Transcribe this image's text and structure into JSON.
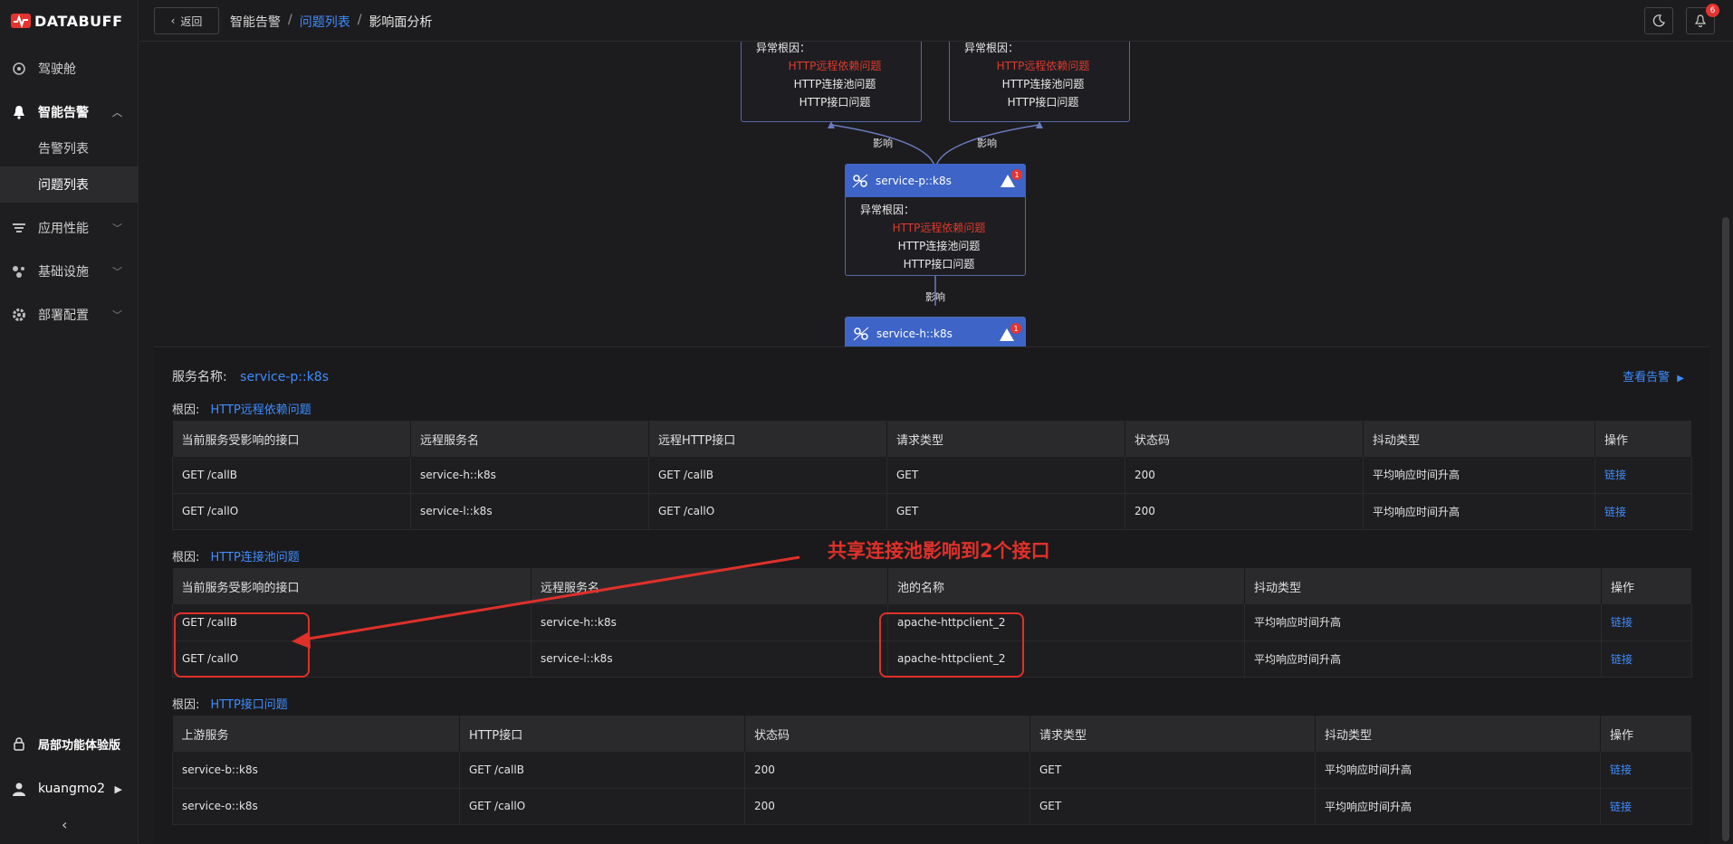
{
  "app": {
    "logo_text": "DATABUFF"
  },
  "sidebar": {
    "items": [
      {
        "label": "驾驶舱",
        "icon": "cockpit-icon"
      },
      {
        "label": "智能告警",
        "icon": "bell-icon"
      },
      {
        "label": "应用性能",
        "icon": "apm-icon"
      },
      {
        "label": "基础设施",
        "icon": "infra-icon"
      },
      {
        "label": "部署配置",
        "icon": "gear-icon"
      }
    ],
    "subitems": [
      "告警列表",
      "问题列表"
    ],
    "trial_label": "局部功能体验版",
    "user_name": "kuangmo2"
  },
  "header": {
    "back_label": "返回",
    "breadcrumb": [
      "智能告警",
      "问题列表",
      "影响面分析"
    ],
    "notification_count": "6"
  },
  "graph": {
    "root_cause_title": "异常根因：",
    "causes": [
      "HTTP远程依赖问题",
      "HTTP连接池问题",
      "HTTP接口问题"
    ],
    "edge_label": "影响",
    "node_p": "service-p::k8s",
    "node_h": "service-h::k8s",
    "alert_count": "1"
  },
  "detail": {
    "service_label": "服务名称:",
    "service_name": "service-p::k8s",
    "view_alerts": "查看告警",
    "cause_prefix": "根因:",
    "tables": [
      {
        "cause": "HTTP远程依赖问题",
        "headers": [
          "当前服务受影响的接口",
          "远程服务名",
          "远程HTTP接口",
          "请求类型",
          "状态码",
          "抖动类型",
          "操作"
        ],
        "rows": [
          [
            "GET /callB",
            "service-h::k8s",
            "GET /callB",
            "GET",
            "200",
            "平均响应时间升高",
            "链接"
          ],
          [
            "GET /callO",
            "service-l::k8s",
            "GET /callO",
            "GET",
            "200",
            "平均响应时间升高",
            "链接"
          ]
        ]
      },
      {
        "cause": "HTTP连接池问题",
        "headers": [
          "当前服务受影响的接口",
          "远程服务名",
          "池的名称",
          "抖动类型",
          "操作"
        ],
        "rows": [
          [
            "GET /callB",
            "service-h::k8s",
            "apache-httpclient_2",
            "平均响应时间升高",
            "链接"
          ],
          [
            "GET /callO",
            "service-l::k8s",
            "apache-httpclient_2",
            "平均响应时间升高",
            "链接"
          ]
        ]
      },
      {
        "cause": "HTTP接口问题",
        "headers": [
          "上游服务",
          "HTTP接口",
          "状态码",
          "请求类型",
          "抖动类型",
          "操作"
        ],
        "rows": [
          [
            "service-b::k8s",
            "GET /callB",
            "200",
            "GET",
            "平均响应时间升高",
            "链接"
          ],
          [
            "service-o::k8s",
            "GET /callO",
            "200",
            "GET",
            "平均响应时间升高",
            "链接"
          ]
        ]
      }
    ],
    "annotation": "共享连接池影响到2个接口"
  },
  "colors": {
    "accent": "#3f8cff",
    "node_header": "#3d64c6",
    "alert_red": "#e03a2e"
  }
}
